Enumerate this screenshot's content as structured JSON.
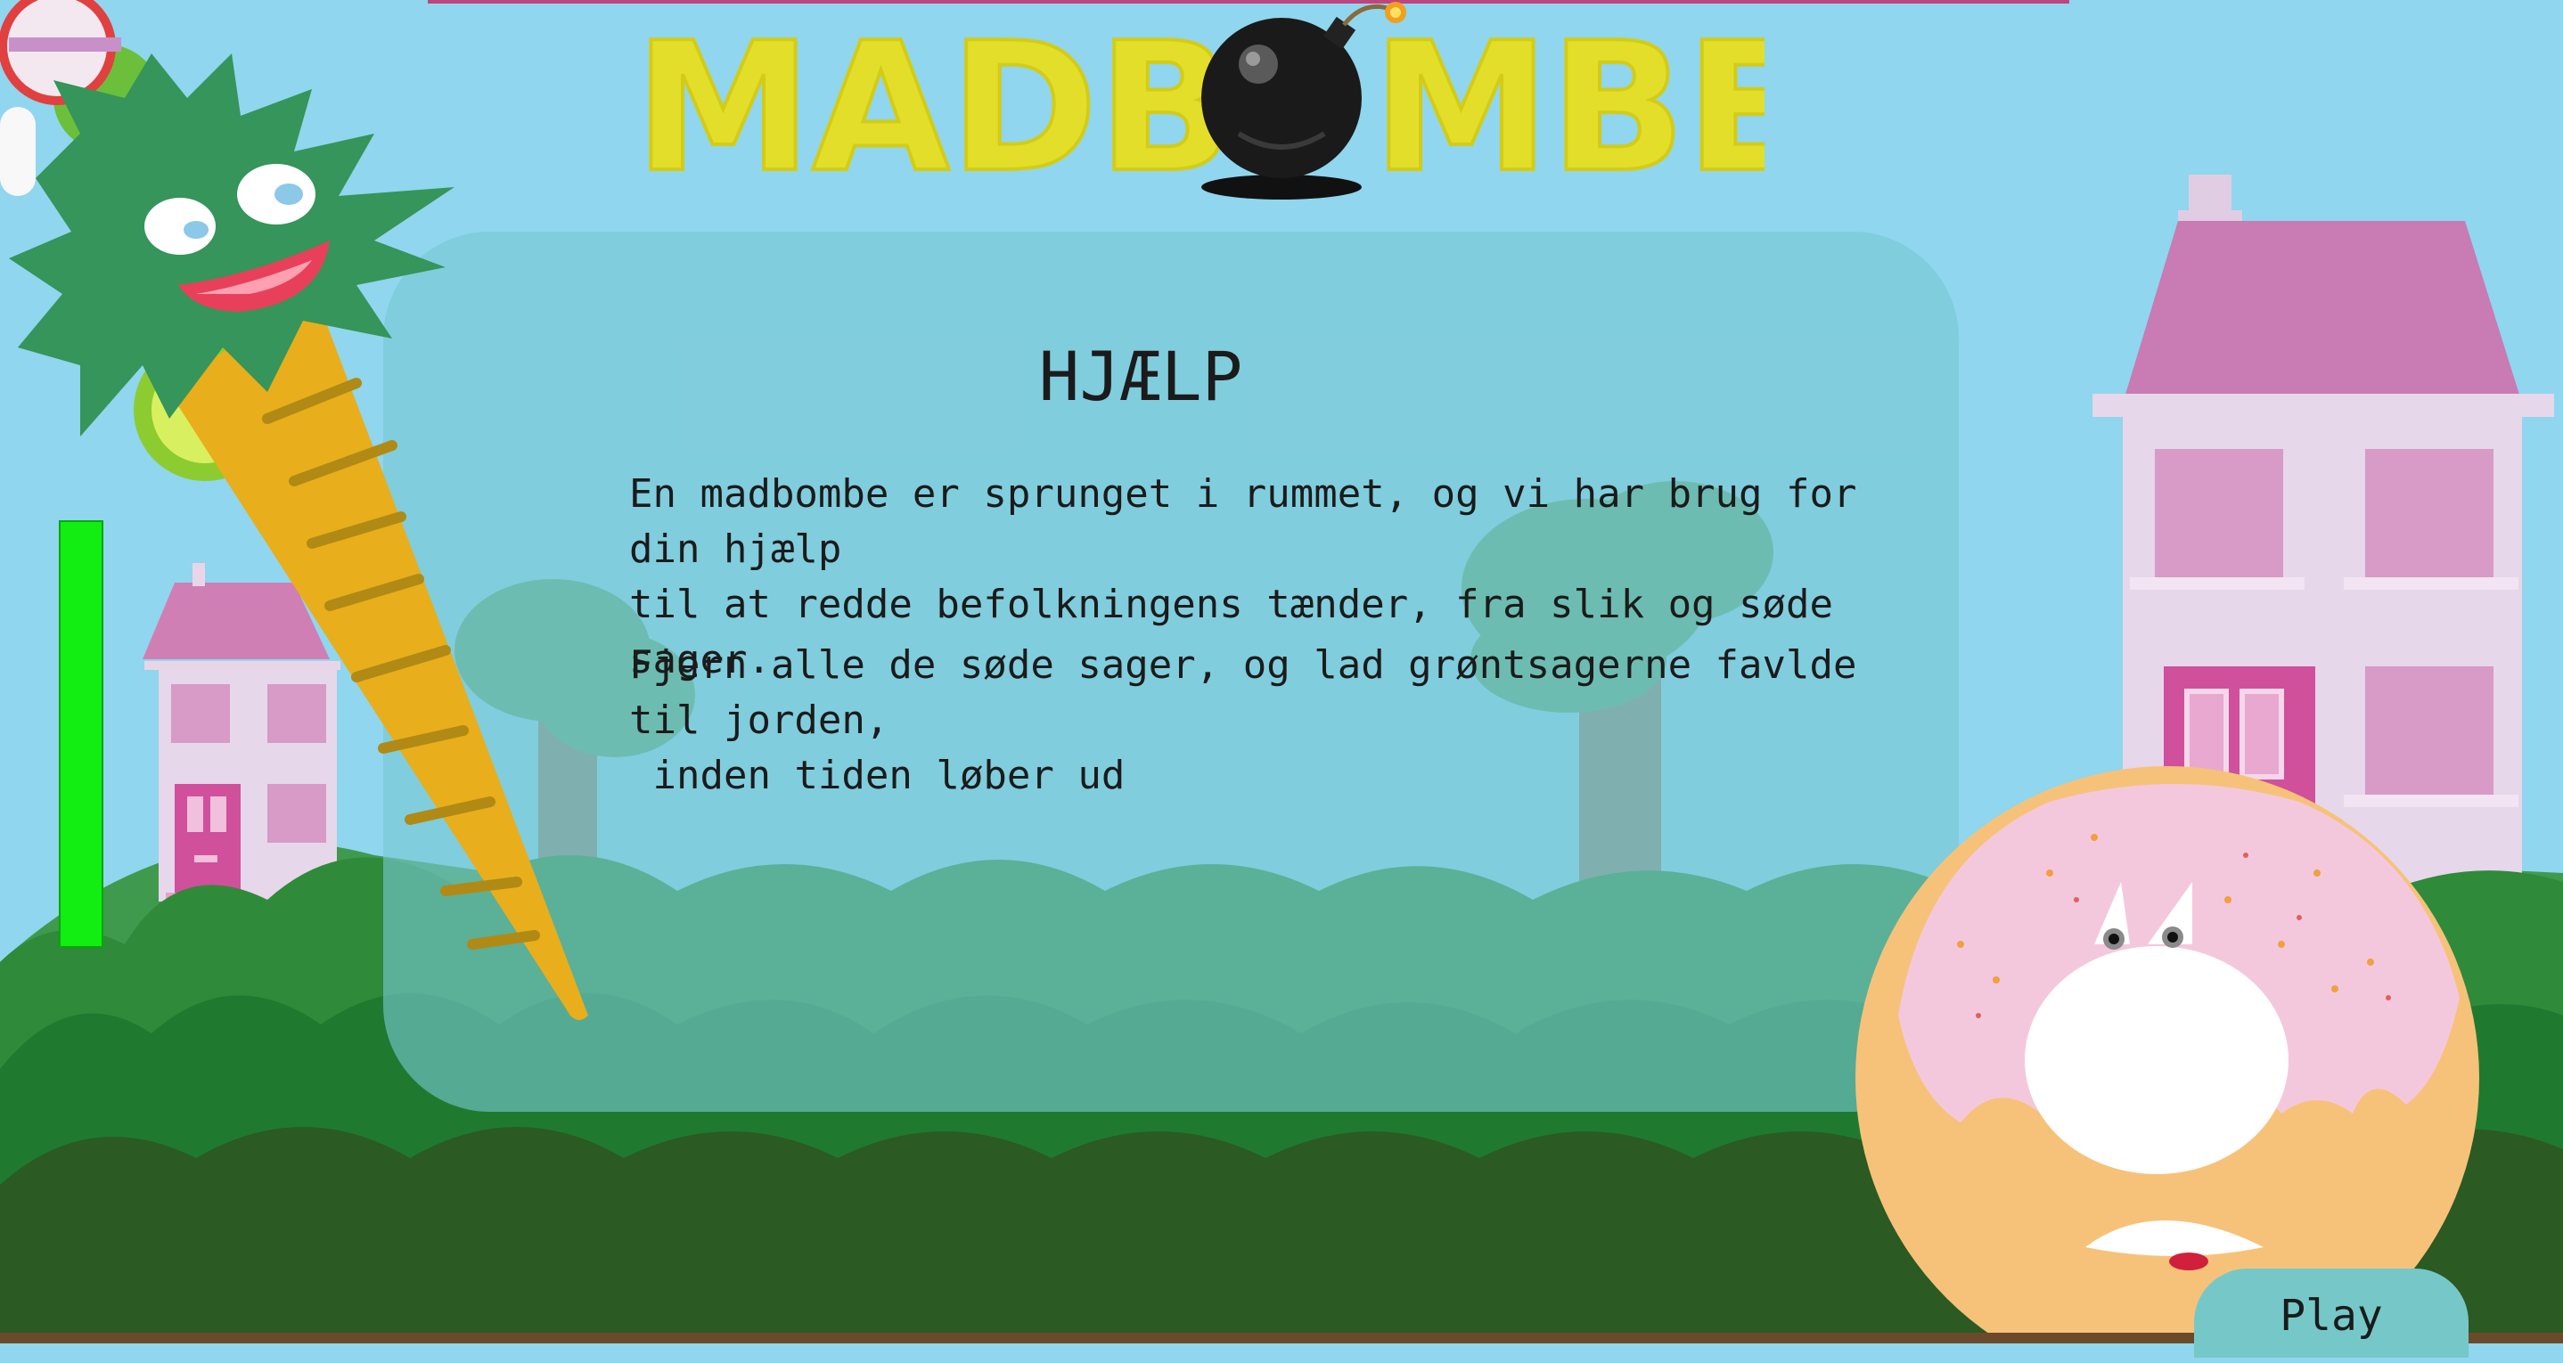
{
  "game": {
    "title": "MADBOMBE",
    "title_left": "MADB",
    "title_right": "MBE",
    "title_color": "#e3de2a"
  },
  "help": {
    "heading": "HJÆLP",
    "paragraph_1": "En madbombe er sprunget i rummet, og vi har brug for din hjælp\ntil at redde befolkningens tænder, fra slik og søde sager.",
    "paragraph_2": "Fjern alle de søde sager, og lad grøntsagerne favlde til jorden,\n inden tiden løber ud"
  },
  "controls": {
    "play_label": "Play"
  },
  "colors": {
    "sky": "#8fd6ee",
    "timer": "#12ee12",
    "panel": "#78c8d2",
    "button": "#76c8c8"
  },
  "icons": {
    "bomb": "bomb-icon",
    "carrot": "carrot-character",
    "donut": "donut-character"
  }
}
